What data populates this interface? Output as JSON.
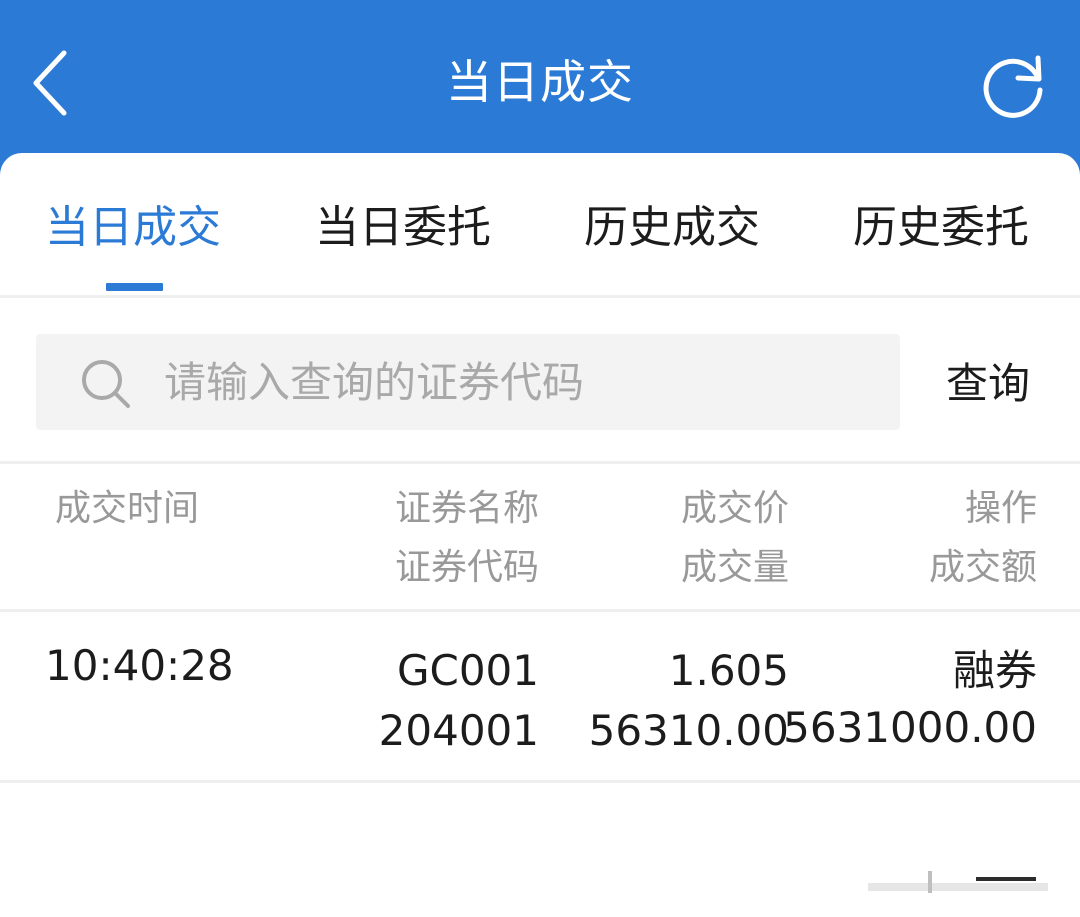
{
  "header": {
    "title": "当日成交"
  },
  "tabs": [
    {
      "label": "当日成交",
      "active": true
    },
    {
      "label": "当日委托",
      "active": false
    },
    {
      "label": "历史成交",
      "active": false
    },
    {
      "label": "历史委托",
      "active": false
    }
  ],
  "search": {
    "placeholder": "请输入查询的证券代码",
    "value": "",
    "button_label": "查询"
  },
  "table": {
    "headers": {
      "time": "成交时间",
      "name": "证券名称",
      "code": "证券代码",
      "price": "成交价",
      "volume": "成交量",
      "action": "操作",
      "amount": "成交额"
    },
    "rows": [
      {
        "time": "10:40:28",
        "name": "GC001",
        "code": "204001",
        "price": "1.605",
        "volume": "56310.00",
        "action": "融券",
        "amount": "5631000.00"
      }
    ]
  },
  "colors": {
    "primary": "#2b7ad5",
    "text": "#1c1c1c",
    "muted": "#999999",
    "divider": "#efefef"
  }
}
